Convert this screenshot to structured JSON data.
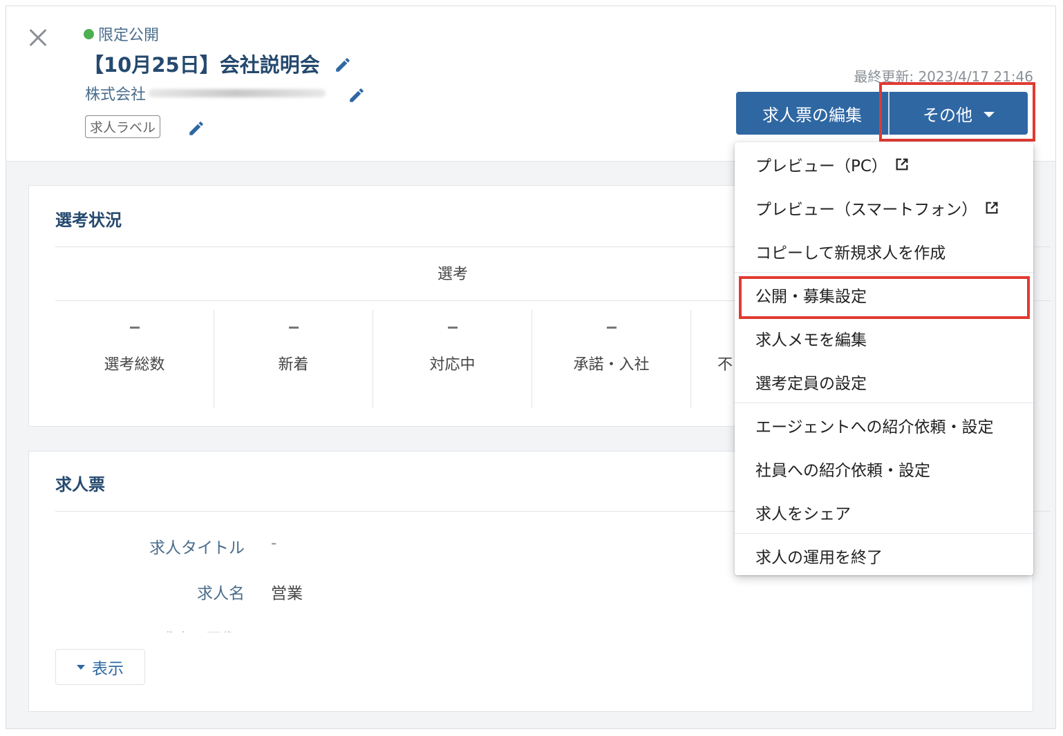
{
  "header": {
    "status": "限定公開",
    "title": "【10月25日】会社説明会",
    "company": "株式会社",
    "label_tag": "求人ラベル",
    "last_updated": "最終更新: 2023/4/17 21:46",
    "edit_button": "求人票の編集",
    "other_button": "その他"
  },
  "selection": {
    "title": "選考状況",
    "group_header": "選考",
    "stats": [
      {
        "value": "-",
        "label": "選考総数"
      },
      {
        "value": "-",
        "label": "新着"
      },
      {
        "value": "-",
        "label": "対応中"
      },
      {
        "value": "-",
        "label": "承諾・入社"
      },
      {
        "value": "-",
        "label": "不"
      }
    ]
  },
  "job_sheet": {
    "title": "求人票",
    "rows": [
      {
        "key": "求人タイトル",
        "value": "-"
      },
      {
        "key": "求人名",
        "value": "営業"
      }
    ],
    "faded_row": "求人・画像",
    "show_button": "表示"
  },
  "menu": {
    "items": [
      "プレビュー（PC）",
      "プレビュー（スマートフォン）",
      "コピーして新規求人を作成",
      "公開・募集設定",
      "求人メモを編集",
      "選考定員の設定",
      "エージェントへの紹介依頼・設定",
      "社員への紹介依頼・設定",
      "求人をシェア",
      "求人の運用を終了"
    ]
  },
  "colors": {
    "primary": "#2f67a3",
    "title": "#25496e",
    "status_dot": "#4caf50",
    "highlight": "#e03a32"
  },
  "icons": [
    "close-icon",
    "pencil-icon",
    "external-link-icon",
    "caret-down-icon"
  ]
}
